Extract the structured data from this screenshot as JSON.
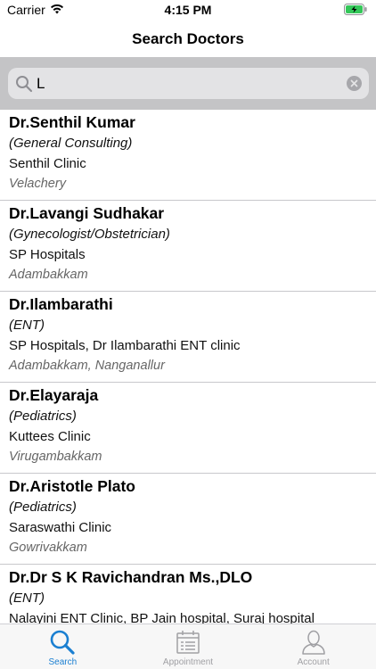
{
  "status_bar": {
    "carrier": "Carrier",
    "time": "4:15 PM"
  },
  "nav": {
    "title": "Search Doctors"
  },
  "search": {
    "value": "L"
  },
  "doctors": [
    {
      "name": "Dr.Senthil Kumar",
      "specialty": "(General Consulting)",
      "clinic": "Senthil Clinic",
      "area": "Velachery"
    },
    {
      "name": "Dr.Lavangi Sudhakar",
      "specialty": "(Gynecologist/Obstetrician)",
      "clinic": "SP Hospitals",
      "area": "Adambakkam"
    },
    {
      "name": "Dr.Ilambarathi",
      "specialty": "(ENT)",
      "clinic": "SP Hospitals, Dr Ilambarathi ENT clinic",
      "area": "Adambakkam, Nanganallur"
    },
    {
      "name": "Dr.Elayaraja",
      "specialty": "(Pediatrics)",
      "clinic": "Kuttees Clinic",
      "area": "Virugambakkam"
    },
    {
      "name": "Dr.Aristotle Plato",
      "specialty": "(Pediatrics)",
      "clinic": "Saraswathi Clinic",
      "area": "Gowrivakkam"
    },
    {
      "name": "Dr.Dr S K Ravichandran Ms.,DLO",
      "specialty": "(ENT)",
      "clinic": "Nalayini ENT Clinic, BP Jain hospital, Suraj hospital",
      "area": ""
    }
  ],
  "tabs": [
    {
      "label": "Search",
      "icon": "search-icon",
      "active": true
    },
    {
      "label": "Appointment",
      "icon": "calendar-icon",
      "active": false
    },
    {
      "label": "Account",
      "icon": "person-icon",
      "active": false
    }
  ],
  "colors": {
    "accent": "#1a7fd1",
    "tab_inactive": "#a0a0a4",
    "search_bar_bg": "#c4c4c6",
    "battery_green": "#34c759"
  }
}
